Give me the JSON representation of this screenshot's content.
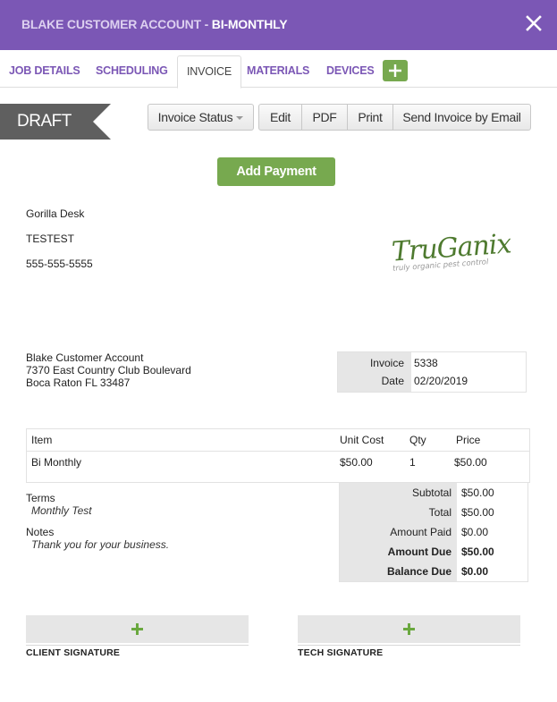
{
  "header": {
    "title_prefix": "BLAKE CUSTOMER ACCOUNT - ",
    "title_suffix": "BI-MONTHLY",
    "close_icon": "close-icon",
    "color": "#7b57b5"
  },
  "tabs": [
    {
      "label": "JOB DETAILS",
      "active": false
    },
    {
      "label": "SCHEDULING",
      "active": false
    },
    {
      "label": "INVOICE",
      "active": true
    },
    {
      "label": "MATERIALS",
      "active": false
    },
    {
      "label": "DEVICES",
      "active": false
    }
  ],
  "tab_add_icon": "plus-icon",
  "status_ribbon": {
    "label": "DRAFT",
    "color": "#5f5f5f"
  },
  "toolbar": {
    "invoice_status": "Invoice Status",
    "edit": "Edit",
    "pdf": "PDF",
    "print": "Print",
    "send_email": "Send Invoice by Email"
  },
  "add_payment": {
    "label": "Add Payment",
    "color": "#77a94f"
  },
  "company": {
    "name": "Gorilla Desk",
    "line2": "TESTEST",
    "phone": "555-555-5555"
  },
  "logo": {
    "brand": "TruGanix",
    "tagline": "truly organic pest control"
  },
  "bill_to": {
    "name": "Blake Customer Account",
    "street": "7370 East Country Club Boulevard",
    "city_state_zip": "Boca Raton FL 33487"
  },
  "invoice_meta": {
    "invoice_label": "Invoice",
    "invoice_number": "5338",
    "date_label": "Date",
    "date": "02/20/2019"
  },
  "items": {
    "columns": [
      "Item",
      "Unit Cost",
      "Qty",
      "Price"
    ],
    "rows": [
      {
        "item": "Bi Monthly",
        "unit_cost": "$50.00",
        "qty": "1",
        "price": "$50.00"
      }
    ]
  },
  "terms": {
    "label": "Terms",
    "value": "Monthly Test"
  },
  "notes": {
    "label": "Notes",
    "value": "Thank you for your business."
  },
  "totals": [
    {
      "label": "Subtotal",
      "value": "$50.00",
      "bold": false
    },
    {
      "label": "Total",
      "value": "$50.00",
      "bold": false
    },
    {
      "label": "Amount Paid",
      "value": "$0.00",
      "bold": false
    },
    {
      "label": "Amount Due",
      "value": "$50.00",
      "bold": true
    },
    {
      "label": "Balance Due",
      "value": "$0.00",
      "bold": true
    }
  ],
  "signatures": {
    "client": "CLIENT SIGNATURE",
    "tech": "TECH SIGNATURE"
  }
}
